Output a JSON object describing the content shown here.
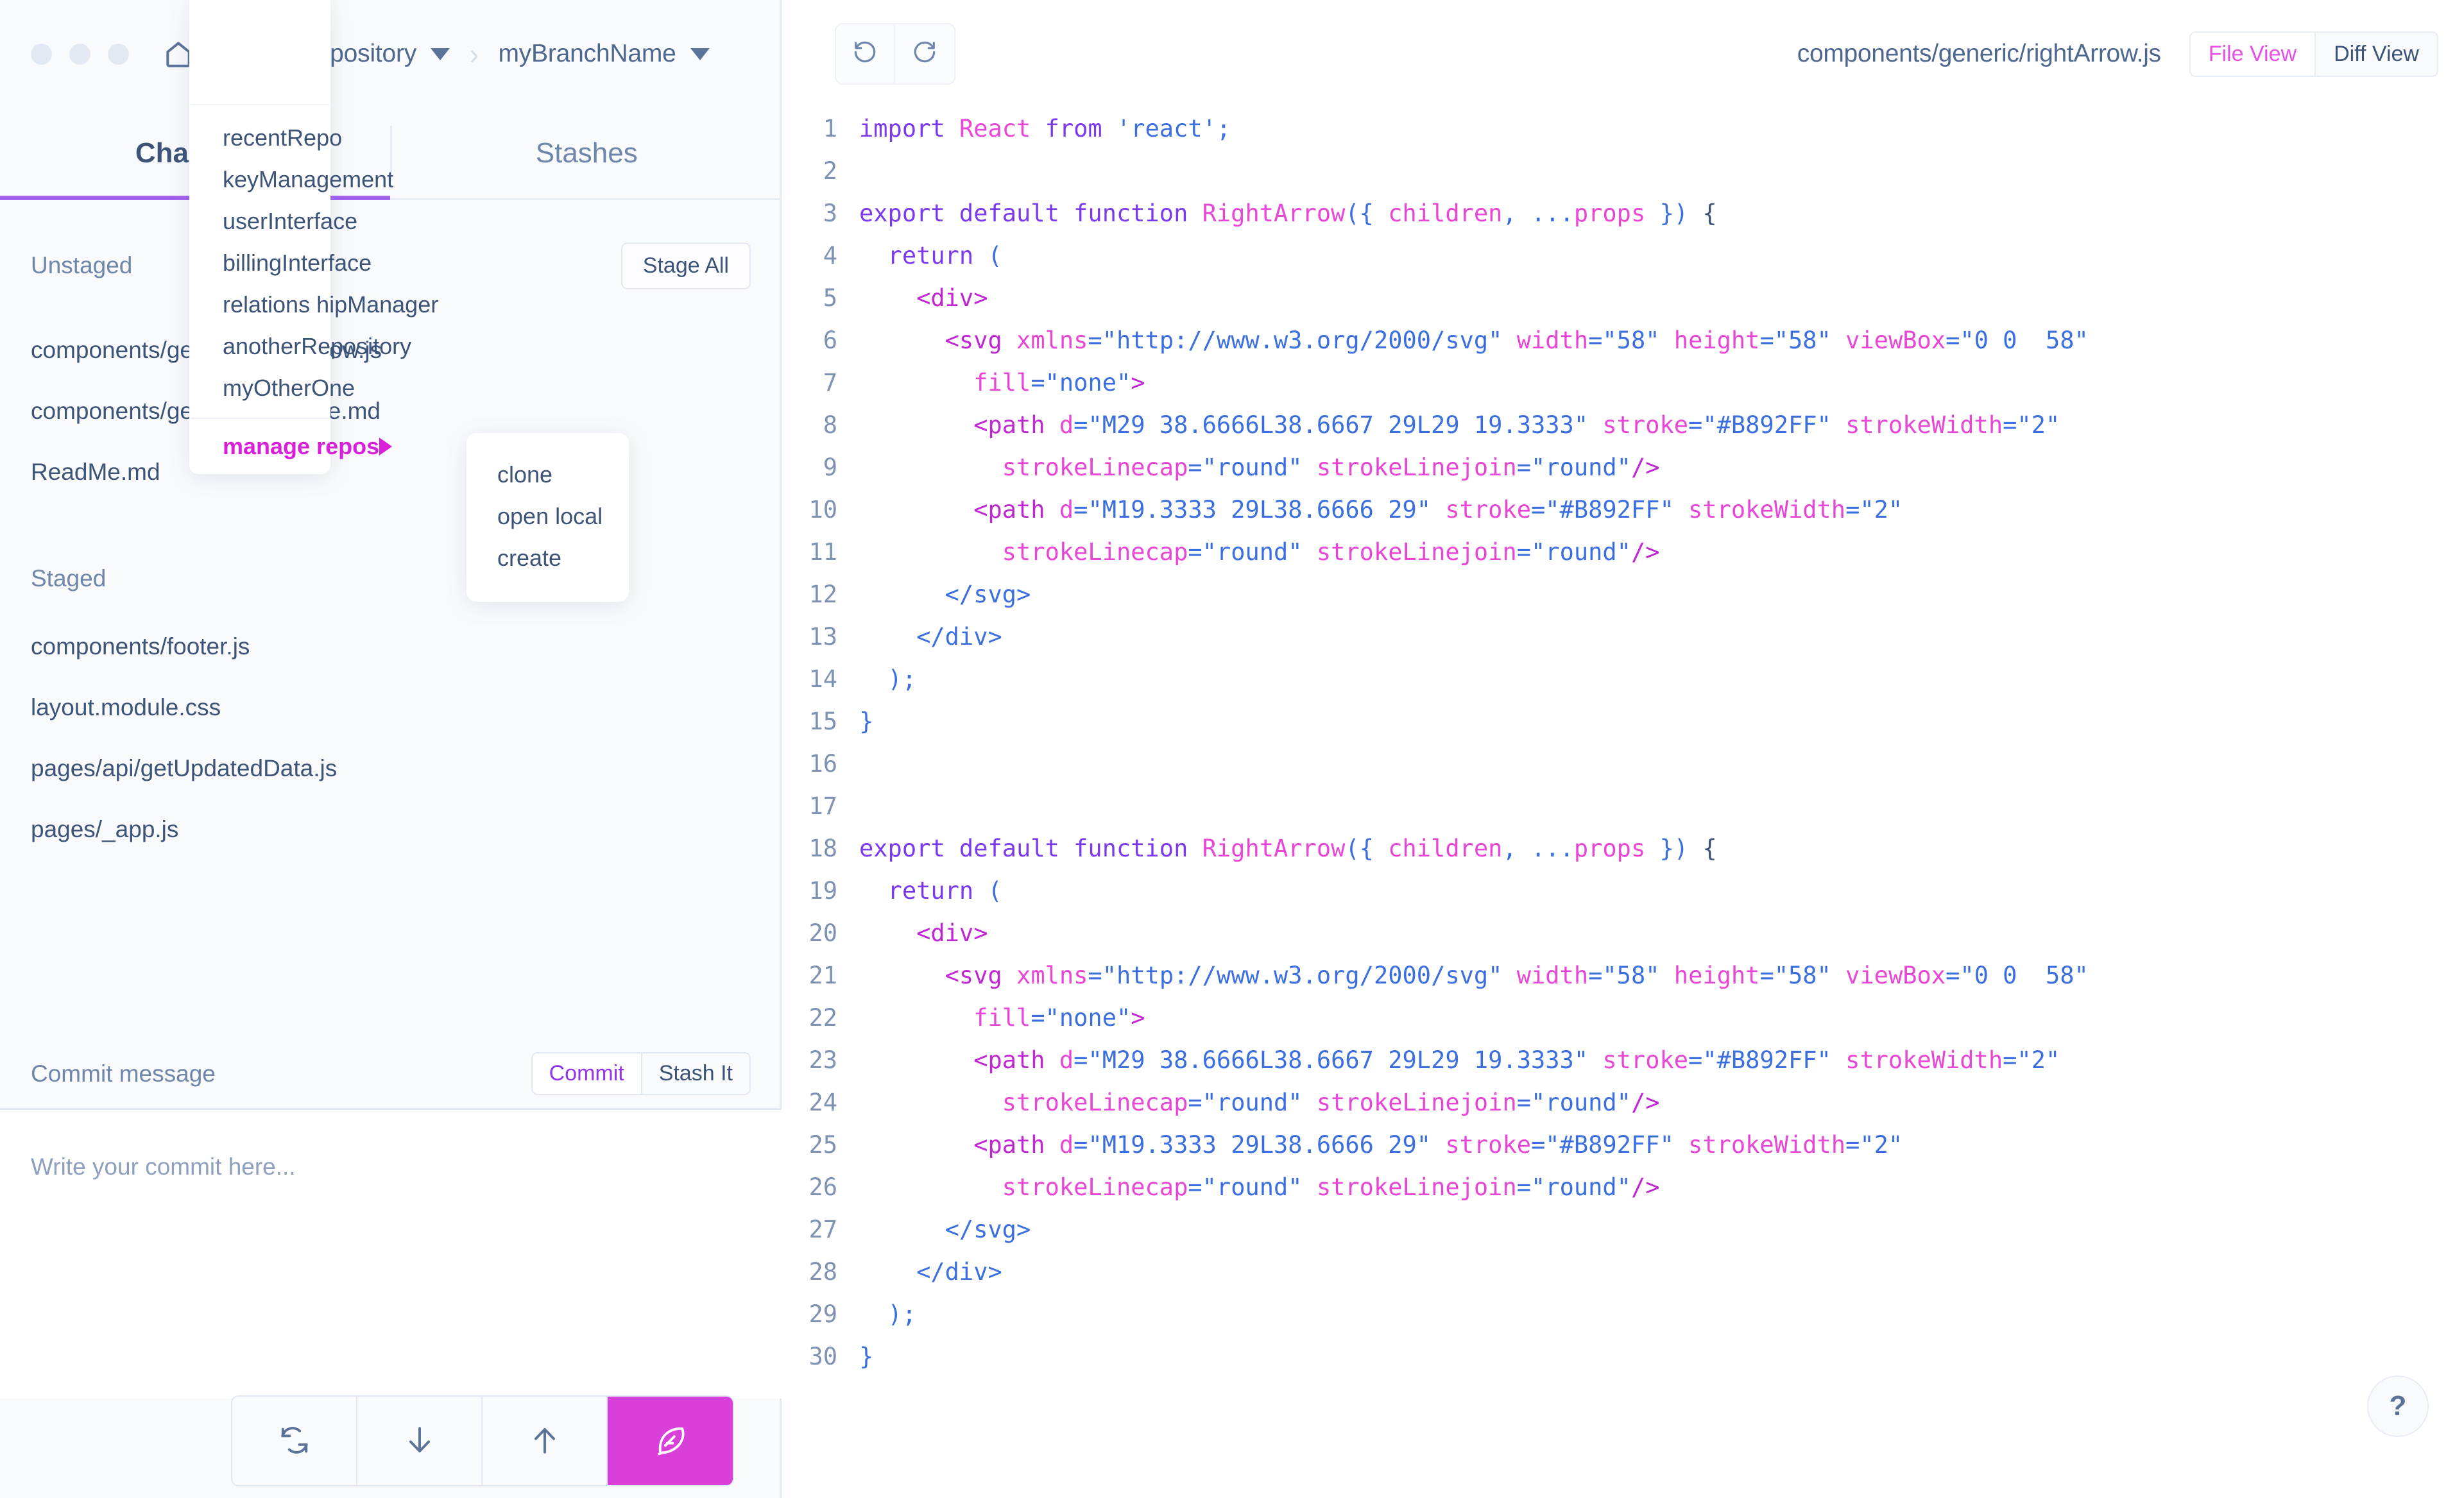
{
  "titlebar": {
    "home_icon": "home-icon",
    "repo_name": "designRepository",
    "separator": "›",
    "branch_name": "myBranchName"
  },
  "tabs": [
    {
      "label": "Changes",
      "active": true
    },
    {
      "label": "Stashes",
      "active": false
    }
  ],
  "unstaged": {
    "title": "Unstaged",
    "stage_all_label": "Stage All",
    "files": [
      "components/generic/rightArrow.js",
      "components/generic/ReadMe.md",
      "ReadMe.md"
    ]
  },
  "staged": {
    "title": "Staged",
    "files": [
      "components/footer.js",
      "layout.module.css",
      "pages/api/getUpdatedData.js",
      "pages/_app.js"
    ]
  },
  "commit": {
    "label": "Commit message",
    "commit_button": "Commit",
    "stash_button": "Stash It",
    "placeholder": "Write your commit here..."
  },
  "bottom_toolbar": [
    {
      "icon": "sync-icon",
      "accent": false
    },
    {
      "icon": "arrow-down-icon",
      "accent": false
    },
    {
      "icon": "arrow-up-icon",
      "accent": false
    },
    {
      "icon": "feather-icon",
      "accent": true
    }
  ],
  "repo_menu": {
    "items": [
      "recentRepo",
      "keyManagement",
      "userInterface",
      "billingInterface",
      "relations hipManager",
      "anotherRepository",
      "myOtherOne"
    ],
    "manage_label": "manage repos",
    "submenu": [
      "clone",
      "open local",
      "create"
    ]
  },
  "editor": {
    "undo_icon": "undo-icon",
    "redo_icon": "redo-icon",
    "file_path": "components/generic/rightArrow.js",
    "file_view_label": "File View",
    "diff_view_label": "Diff View",
    "help_label": "?"
  },
  "code": {
    "lines": [
      {
        "n": "1",
        "tokens": [
          [
            "import ",
            "kw"
          ],
          [
            "React",
            "id"
          ],
          [
            " from ",
            "kw"
          ],
          [
            "'react'",
            "str"
          ],
          [
            ";",
            "pun"
          ]
        ]
      },
      {
        "n": "2",
        "tokens": []
      },
      {
        "n": "3",
        "tokens": [
          [
            "export default function ",
            "kw"
          ],
          [
            "RightArrow",
            "id"
          ],
          [
            "(",
            "pun"
          ],
          [
            "{ ",
            "pun"
          ],
          [
            "children",
            "id"
          ],
          [
            ", ",
            "pun"
          ],
          [
            "...",
            "pun"
          ],
          [
            "props",
            "id"
          ],
          [
            " }",
            "pun"
          ],
          [
            ")",
            "pun"
          ],
          [
            " {",
            "plain"
          ]
        ]
      },
      {
        "n": "4",
        "tokens": [
          [
            "  return ",
            "kw"
          ],
          [
            "(",
            "pun"
          ]
        ]
      },
      {
        "n": "5",
        "tokens": [
          [
            "    <div>",
            "tag"
          ]
        ]
      },
      {
        "n": "6",
        "tokens": [
          [
            "      <svg ",
            "tag"
          ],
          [
            "xmlns",
            "attr"
          ],
          [
            "=",
            "pun"
          ],
          [
            "\"http://www.w3.org/2000/svg\"",
            "str"
          ],
          [
            " ",
            "pun"
          ],
          [
            "width",
            "attr"
          ],
          [
            "=",
            "pun"
          ],
          [
            "\"58\"",
            "str"
          ],
          [
            " ",
            "pun"
          ],
          [
            "height",
            "attr"
          ],
          [
            "=",
            "pun"
          ],
          [
            "\"58\"",
            "str"
          ],
          [
            " ",
            "pun"
          ],
          [
            "viewBox",
            "attr"
          ],
          [
            "=",
            "pun"
          ],
          [
            "\"0 0  58\"",
            "str"
          ]
        ]
      },
      {
        "n": "7",
        "tokens": [
          [
            "        ",
            "pun"
          ],
          [
            "fill",
            "attr"
          ],
          [
            "=",
            "pun"
          ],
          [
            "\"none\"",
            "str"
          ],
          [
            ">",
            "tag"
          ]
        ]
      },
      {
        "n": "8",
        "tokens": [
          [
            "        <path ",
            "tag"
          ],
          [
            "d",
            "attr"
          ],
          [
            "=",
            "pun"
          ],
          [
            "\"M29 38.6666L38.6667 29L29 19.3333\"",
            "str"
          ],
          [
            " ",
            "pun"
          ],
          [
            "stroke",
            "attr"
          ],
          [
            "=",
            "pun"
          ],
          [
            "\"#B892FF\"",
            "str"
          ],
          [
            " ",
            "pun"
          ],
          [
            "strokeWidth",
            "attr"
          ],
          [
            "=",
            "pun"
          ],
          [
            "\"2\"",
            "str"
          ]
        ]
      },
      {
        "n": "9",
        "tokens": [
          [
            "          ",
            "pun"
          ],
          [
            "strokeLinecap",
            "attr"
          ],
          [
            "=",
            "pun"
          ],
          [
            "\"round\"",
            "str"
          ],
          [
            " ",
            "pun"
          ],
          [
            "strokeLinejoin",
            "attr"
          ],
          [
            "=",
            "pun"
          ],
          [
            "\"round\"",
            "str"
          ],
          [
            "/>",
            "tag"
          ]
        ]
      },
      {
        "n": "10",
        "tokens": [
          [
            "        <path ",
            "tag"
          ],
          [
            "d",
            "attr"
          ],
          [
            "=",
            "pun"
          ],
          [
            "\"M19.3333 29L38.6666 29\"",
            "str"
          ],
          [
            " ",
            "pun"
          ],
          [
            "stroke",
            "attr"
          ],
          [
            "=",
            "pun"
          ],
          [
            "\"#B892FF\"",
            "str"
          ],
          [
            " ",
            "pun"
          ],
          [
            "strokeWidth",
            "attr"
          ],
          [
            "=",
            "pun"
          ],
          [
            "\"2\"",
            "str"
          ]
        ]
      },
      {
        "n": "11",
        "tokens": [
          [
            "          ",
            "pun"
          ],
          [
            "strokeLinecap",
            "attr"
          ],
          [
            "=",
            "pun"
          ],
          [
            "\"round\"",
            "str"
          ],
          [
            " ",
            "pun"
          ],
          [
            "strokeLinejoin",
            "attr"
          ],
          [
            "=",
            "pun"
          ],
          [
            "\"round\"",
            "str"
          ],
          [
            "/>",
            "tag"
          ]
        ]
      },
      {
        "n": "12",
        "tokens": [
          [
            "      </svg>",
            "str"
          ]
        ]
      },
      {
        "n": "13",
        "tokens": [
          [
            "    </div>",
            "str"
          ]
        ]
      },
      {
        "n": "14",
        "tokens": [
          [
            "  );",
            "str"
          ]
        ]
      },
      {
        "n": "15",
        "tokens": [
          [
            "}",
            "str"
          ]
        ]
      },
      {
        "n": "16",
        "tokens": []
      },
      {
        "n": "17",
        "tokens": []
      },
      {
        "n": "18",
        "tokens": [
          [
            "export default function ",
            "kw"
          ],
          [
            "RightArrow",
            "id"
          ],
          [
            "(",
            "pun"
          ],
          [
            "{ ",
            "pun"
          ],
          [
            "children",
            "id"
          ],
          [
            ", ",
            "pun"
          ],
          [
            "...",
            "pun"
          ],
          [
            "props",
            "id"
          ],
          [
            " }",
            "pun"
          ],
          [
            ")",
            "pun"
          ],
          [
            " {",
            "plain"
          ]
        ]
      },
      {
        "n": "19",
        "tokens": [
          [
            "  return ",
            "kw"
          ],
          [
            "(",
            "pun"
          ]
        ]
      },
      {
        "n": "20",
        "tokens": [
          [
            "    <div>",
            "tag"
          ]
        ]
      },
      {
        "n": "21",
        "tokens": [
          [
            "      <svg ",
            "tag"
          ],
          [
            "xmlns",
            "attr"
          ],
          [
            "=",
            "pun"
          ],
          [
            "\"http://www.w3.org/2000/svg\"",
            "str"
          ],
          [
            " ",
            "pun"
          ],
          [
            "width",
            "attr"
          ],
          [
            "=",
            "pun"
          ],
          [
            "\"58\"",
            "str"
          ],
          [
            " ",
            "pun"
          ],
          [
            "height",
            "attr"
          ],
          [
            "=",
            "pun"
          ],
          [
            "\"58\"",
            "str"
          ],
          [
            " ",
            "pun"
          ],
          [
            "viewBox",
            "attr"
          ],
          [
            "=",
            "pun"
          ],
          [
            "\"0 0  58\"",
            "str"
          ]
        ]
      },
      {
        "n": "22",
        "tokens": [
          [
            "        ",
            "pun"
          ],
          [
            "fill",
            "attr"
          ],
          [
            "=",
            "pun"
          ],
          [
            "\"none\"",
            "str"
          ],
          [
            ">",
            "tag"
          ]
        ]
      },
      {
        "n": "23",
        "tokens": [
          [
            "        <path ",
            "tag"
          ],
          [
            "d",
            "attr"
          ],
          [
            "=",
            "pun"
          ],
          [
            "\"M29 38.6666L38.6667 29L29 19.3333\"",
            "str"
          ],
          [
            " ",
            "pun"
          ],
          [
            "stroke",
            "attr"
          ],
          [
            "=",
            "pun"
          ],
          [
            "\"#B892FF\"",
            "str"
          ],
          [
            " ",
            "pun"
          ],
          [
            "strokeWidth",
            "attr"
          ],
          [
            "=",
            "pun"
          ],
          [
            "\"2\"",
            "str"
          ]
        ]
      },
      {
        "n": "24",
        "tokens": [
          [
            "          ",
            "pun"
          ],
          [
            "strokeLinecap",
            "attr"
          ],
          [
            "=",
            "pun"
          ],
          [
            "\"round\"",
            "str"
          ],
          [
            " ",
            "pun"
          ],
          [
            "strokeLinejoin",
            "attr"
          ],
          [
            "=",
            "pun"
          ],
          [
            "\"round\"",
            "str"
          ],
          [
            "/>",
            "tag"
          ]
        ]
      },
      {
        "n": "25",
        "tokens": [
          [
            "        <path ",
            "tag"
          ],
          [
            "d",
            "attr"
          ],
          [
            "=",
            "pun"
          ],
          [
            "\"M19.3333 29L38.6666 29\"",
            "str"
          ],
          [
            " ",
            "pun"
          ],
          [
            "stroke",
            "attr"
          ],
          [
            "=",
            "pun"
          ],
          [
            "\"#B892FF\"",
            "str"
          ],
          [
            " ",
            "pun"
          ],
          [
            "strokeWidth",
            "attr"
          ],
          [
            "=",
            "pun"
          ],
          [
            "\"2\"",
            "str"
          ]
        ]
      },
      {
        "n": "26",
        "tokens": [
          [
            "          ",
            "pun"
          ],
          [
            "strokeLinecap",
            "attr"
          ],
          [
            "=",
            "pun"
          ],
          [
            "\"round\"",
            "str"
          ],
          [
            " ",
            "pun"
          ],
          [
            "strokeLinejoin",
            "attr"
          ],
          [
            "=",
            "pun"
          ],
          [
            "\"round\"",
            "str"
          ],
          [
            "/>",
            "tag"
          ]
        ]
      },
      {
        "n": "27",
        "tokens": [
          [
            "      </svg>",
            "str"
          ]
        ]
      },
      {
        "n": "28",
        "tokens": [
          [
            "    </div>",
            "str"
          ]
        ]
      },
      {
        "n": "29",
        "tokens": [
          [
            "  );",
            "str"
          ]
        ]
      },
      {
        "n": "30",
        "tokens": [
          [
            "}",
            "str"
          ]
        ]
      }
    ]
  },
  "colors": {
    "accent_pink": "#d93fd9",
    "accent_purple": "#a463f2",
    "text_primary": "#3d5478",
    "text_muted": "#6f86aa",
    "panel_bg": "#f9fafc",
    "border": "#e2e8f2"
  }
}
